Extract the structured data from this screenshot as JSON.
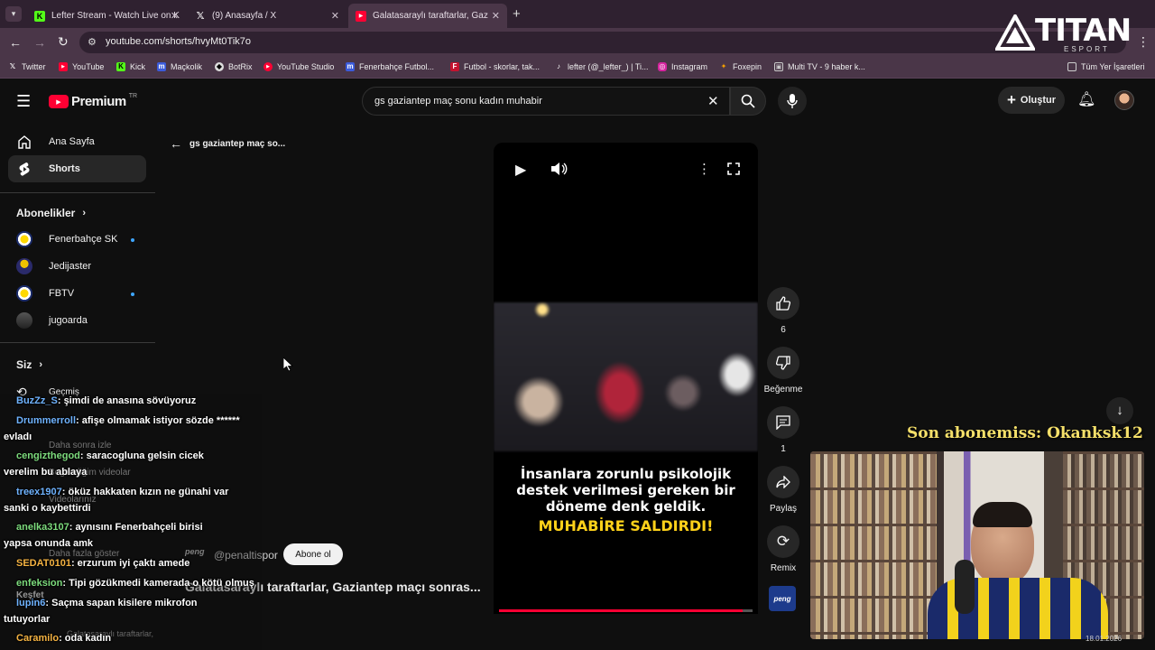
{
  "tabs": [
    {
      "title": "Lefter Stream - Watch Live on Kick",
      "short": "Lefter Stream - Watch Live on K",
      "icon": "kick-icon",
      "color": "#53fc18"
    },
    {
      "title": "(9) Anasayfa / X",
      "short": "(9) Anasayfa / X",
      "icon": "x-icon",
      "color": "#ffffff"
    },
    {
      "title": "Galatasaraylı taraftarlar, Gaziantep",
      "short": "Galatasaraylı taraftarlar, Gazian",
      "icon": "youtube-icon",
      "color": "#ff0033"
    }
  ],
  "address": {
    "url": "youtube.com/shorts/hvyMt0Tik7o"
  },
  "bookmarks": [
    {
      "label": "Twitter",
      "icon": "x-icon"
    },
    {
      "label": "YouTube",
      "icon": "youtube-icon"
    },
    {
      "label": "Kick",
      "icon": "kick-icon"
    },
    {
      "label": "Maçkolik",
      "icon": "mackolik-icon"
    },
    {
      "label": "BotRix",
      "icon": "botrix-icon"
    },
    {
      "label": "YouTube Studio",
      "icon": "youtube-studio-icon"
    },
    {
      "label": "Fenerbahçe Futbol...",
      "icon": "maçkolik-icon"
    },
    {
      "label": "Futbol - skorlar, tak...",
      "icon": "flashscore-icon"
    },
    {
      "label": "lefter (@_lefter_) | Ti...",
      "icon": "tiktok-icon"
    },
    {
      "label": "Instagram",
      "icon": "instagram-icon"
    },
    {
      "label": "Foxepin",
      "icon": "foxepin-icon"
    },
    {
      "label": "Multi TV - 9 haber k...",
      "icon": "multitv-icon"
    }
  ],
  "bookmarks_all": "Tüm Yer İşaretleri",
  "watermark": {
    "brand": "TITAN",
    "sub": "ESPORT"
  },
  "yt": {
    "logo": "Premium",
    "region": "TR",
    "search_value": "gs gaziantep maç sonu kadın muhabir",
    "create": "Oluştur",
    "back_label": "gs gaziantep maç so...",
    "sidebar": {
      "home": "Ana Sayfa",
      "shorts": "Shorts",
      "subscriptions": "Abonelikler",
      "subs": [
        "Fenerbahçe SK",
        "Jedijaster",
        "FBTV",
        "jugoarda"
      ],
      "you": "Siz",
      "history": "Geçmiş",
      "watch_later": "Daha sonra izle",
      "liked": "Beğendiğim videolar",
      "your_videos": "Videolarınız",
      "show_more": "Daha fazla göster",
      "explore": "Keşfet"
    },
    "video": {
      "caption_line1": "İnsanlara zorunlu psikolojik",
      "caption_line2": "destek verilmesi gereken bir",
      "caption_line3": "döneme denk geldik.",
      "headline": "MUHABİRE SALDIRDI!",
      "channel": "@penaltispor",
      "channel_logo": "peng",
      "subscribe": "Abone ol",
      "title": "Galatasaraylı taraftarlar, Gaziantep maçı sonras...",
      "progress": 0.96
    },
    "actions": {
      "likes": "6",
      "dislike": "Beğenme",
      "comments": "1",
      "share": "Paylaş",
      "remix": "Remix"
    },
    "bottom_tab": "Galatasaraylı taraftarlar,"
  },
  "overlay": {
    "sub_banner": "Son abonemiss: Okanksk12",
    "chat": [
      {
        "user": "BuzZz_S",
        "msg": ": şimdi de anasına sövüyoruz",
        "cls": "u"
      },
      {
        "user": "Drummerroll",
        "msg": ": afişe olmamak istiyor sözde ******",
        "cls": "u"
      },
      {
        "user": "",
        "msg": "evladı",
        "cls": ""
      },
      {
        "user": "cengizthegod",
        "msg": ": saracogluna gelsin cicek",
        "cls": "g"
      },
      {
        "user": "",
        "msg": "verelim bu ablaya",
        "cls": ""
      },
      {
        "user": "treex1907",
        "msg": ": öküz hakkaten kızın ne günahi var",
        "cls": "u"
      },
      {
        "user": "",
        "msg": "sanki o kaybettirdi",
        "cls": ""
      },
      {
        "user": "anelka3107",
        "msg": ": aynısını Fenerbahçeli birisi",
        "cls": "g"
      },
      {
        "user": "",
        "msg": "yapsa onunda amk",
        "cls": ""
      },
      {
        "user": "SEDAT0101",
        "msg": ": erzurum iyi çaktı amede",
        "cls": "y"
      },
      {
        "user": "enfeksion",
        "msg": ": Tipi gözükmedi kamerada o kötü olmuş",
        "cls": "g"
      },
      {
        "user": "lupin6",
        "msg": ": Saçma sapan kisilere mikrofon",
        "cls": "u"
      },
      {
        "user": "",
        "msg": "tutuyorlar",
        "cls": ""
      },
      {
        "user": "Caramilo",
        "msg": ": oda kadın",
        "cls": "y"
      }
    ],
    "date": "18.01.2026"
  }
}
